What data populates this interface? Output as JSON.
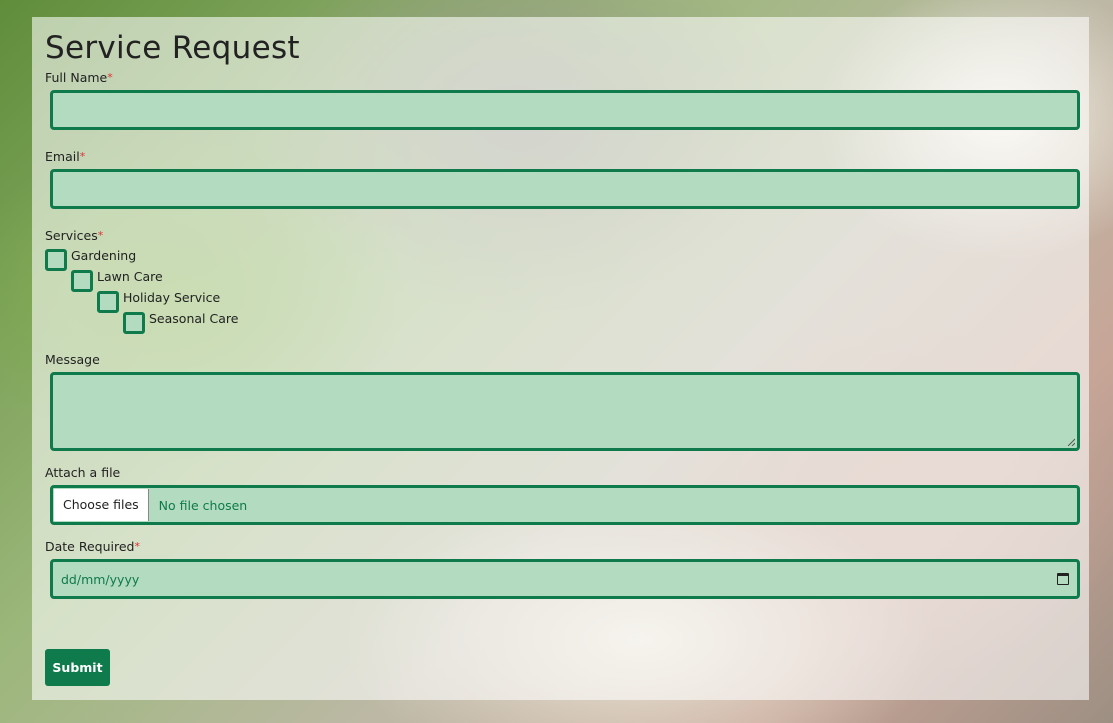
{
  "form": {
    "title": "Service Request",
    "required_marker": "*",
    "full_name_label": "Full Name",
    "email_label": "Email",
    "services_label": "Services",
    "services": [
      "Gardening",
      "Lawn Care",
      "Holiday Service",
      "Seasonal Care"
    ],
    "message_label": "Message",
    "attach_label": "Attach a file",
    "file_button": "Choose files",
    "file_status": "No file chosen",
    "date_label": "Date Required",
    "date_placeholder": "dd/mm/yyyy",
    "submit_label": "Submit"
  },
  "colors": {
    "accent": "#0f7a4c",
    "field_fill": "#b2dbbf",
    "required": "#dd3333"
  }
}
